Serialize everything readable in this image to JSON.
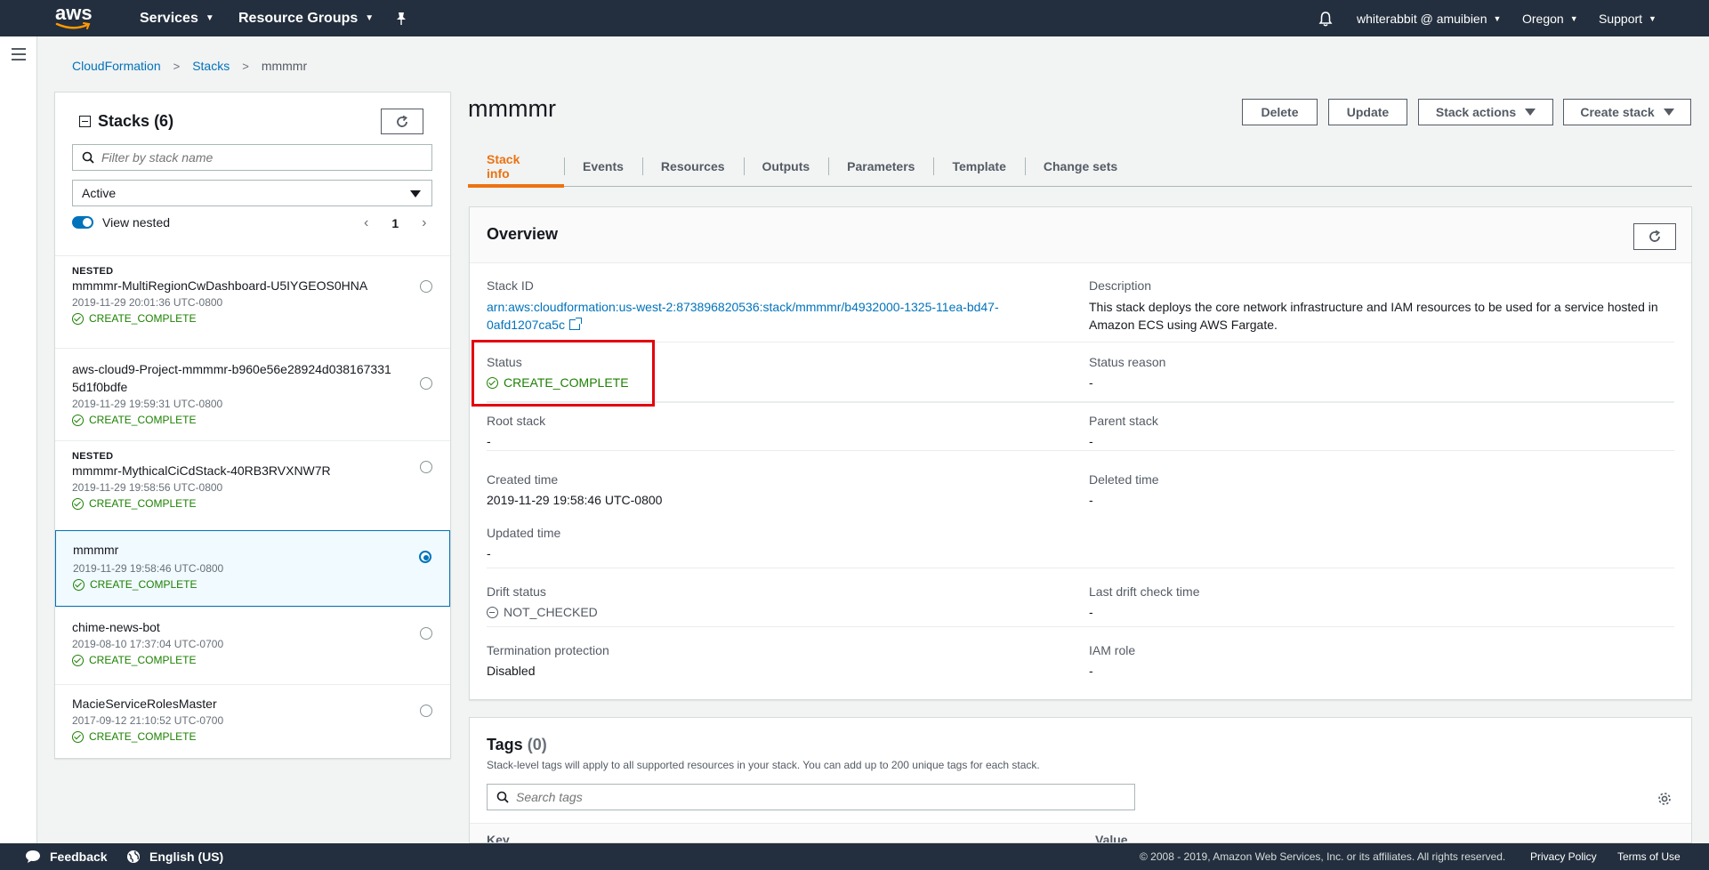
{
  "topnav": {
    "logo": "aws",
    "services": "Services",
    "resource_groups": "Resource Groups",
    "user": "whiterabbit @ amuibien",
    "region": "Oregon",
    "support": "Support"
  },
  "breadcrumb": {
    "root": "CloudFormation",
    "stacks": "Stacks",
    "current": "mmmmr"
  },
  "stacks_panel": {
    "title": "Stacks",
    "count": "(6)",
    "filter_placeholder": "Filter by stack name",
    "select_value": "Active",
    "view_nested": "View nested",
    "page": "1",
    "items": [
      {
        "nested": "NESTED",
        "name": "mmmmr-MultiRegionCwDashboard-U5IYGEOS0HNA",
        "time": "2019-11-29 20:01:36 UTC-0800",
        "status": "CREATE_COMPLETE"
      },
      {
        "nested": "",
        "name": "aws-cloud9-Project-mmmmr-b960e56e28924d0381673315d1f0bdfe",
        "time": "2019-11-29 19:59:31 UTC-0800",
        "status": "CREATE_COMPLETE"
      },
      {
        "nested": "NESTED",
        "name": "mmmmr-MythicalCiCdStack-40RB3RVXNW7R",
        "time": "2019-11-29 19:58:56 UTC-0800",
        "status": "CREATE_COMPLETE"
      },
      {
        "nested": "",
        "name": "mmmmr",
        "time": "2019-11-29 19:58:46 UTC-0800",
        "status": "CREATE_COMPLETE"
      },
      {
        "nested": "",
        "name": "chime-news-bot",
        "time": "2019-08-10 17:37:04 UTC-0700",
        "status": "CREATE_COMPLETE"
      },
      {
        "nested": "",
        "name": "MacieServiceRolesMaster",
        "time": "2017-09-12 21:10:52 UTC-0700",
        "status": "CREATE_COMPLETE"
      }
    ]
  },
  "stack": {
    "title": "mmmmr",
    "buttons": {
      "delete": "Delete",
      "update": "Update",
      "stack_actions": "Stack actions",
      "create_stack": "Create stack"
    },
    "tabs": [
      "Stack info",
      "Events",
      "Resources",
      "Outputs",
      "Parameters",
      "Template",
      "Change sets"
    ]
  },
  "overview": {
    "title": "Overview",
    "stack_id_label": "Stack ID",
    "stack_id_line1": "arn:aws:cloudformation:us-west-2:873896820536:stack/mmmmr/b4932000-1325-11ea-bd47-",
    "stack_id_line2": "0afd1207ca5c",
    "description_label": "Description",
    "description": "This stack deploys the core network infrastructure and IAM resources to be used for a service hosted in Amazon ECS using AWS Fargate.",
    "status_label": "Status",
    "status": "CREATE_COMPLETE",
    "status_reason_label": "Status reason",
    "status_reason": "-",
    "root_stack_label": "Root stack",
    "root_stack": "-",
    "parent_stack_label": "Parent stack",
    "parent_stack": "-",
    "created_time_label": "Created time",
    "created_time": "2019-11-29 19:58:46 UTC-0800",
    "deleted_time_label": "Deleted time",
    "deleted_time": "-",
    "updated_time_label": "Updated time",
    "updated_time": "-",
    "drift_status_label": "Drift status",
    "drift_status": "NOT_CHECKED",
    "last_drift_label": "Last drift check time",
    "last_drift": "-",
    "termination_label": "Termination protection",
    "termination": "Disabled",
    "iam_role_label": "IAM role",
    "iam_role": "-"
  },
  "tags": {
    "title": "Tags",
    "count": "(0)",
    "description": "Stack-level tags will apply to all supported resources in your stack. You can add up to 200 unique tags for each stack.",
    "search_placeholder": "Search tags",
    "col_key": "Key",
    "col_value": "Value"
  },
  "footer": {
    "feedback": "Feedback",
    "language": "English (US)",
    "copyright": "© 2008 - 2019, Amazon Web Services, Inc. or its affiliates. All rights reserved.",
    "privacy": "Privacy Policy",
    "terms": "Terms of Use"
  },
  "colors": {
    "nav_bg": "#232f3e",
    "link": "#0073bb",
    "accent": "#ec7211",
    "success": "#1d8102",
    "highlight": "#e3000f"
  }
}
